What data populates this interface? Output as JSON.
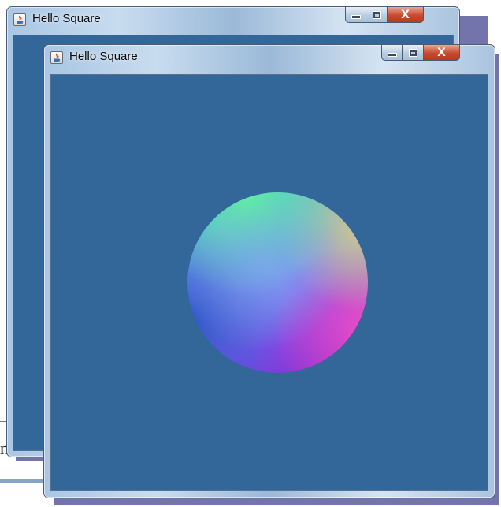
{
  "windows": {
    "back": {
      "title": "Hello Square",
      "close_glyph": "X"
    },
    "front": {
      "title": "Hello Square",
      "close_glyph": "X"
    }
  },
  "icons": {
    "app_icon": "java-app-icon",
    "minimize": "minimize-icon",
    "maximize": "maximize-icon",
    "close": "close-icon"
  },
  "colors": {
    "client_background": "#336699",
    "shadow": "#6a6da6",
    "close_button": "#c94a30"
  },
  "background_text": {
    "fragment": "n"
  },
  "scene": {
    "object": "normal-shaded-sphere"
  }
}
